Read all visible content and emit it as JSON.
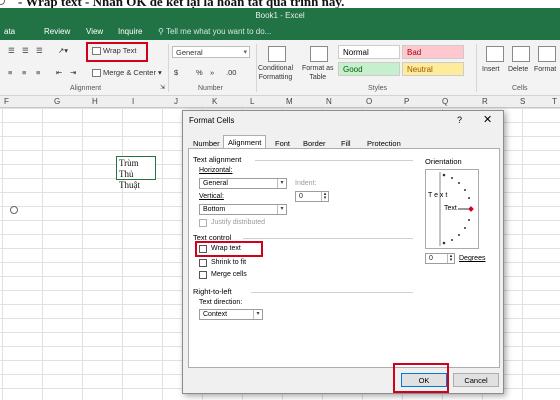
{
  "caption": {
    "text": "- Wrap text - Nhấn OK để kết lại là hoàn tất quá trình này."
  },
  "window": {
    "title": "Book1 - Excel"
  },
  "ribbon_tabs": [
    "ata",
    "Review",
    "View",
    "Inquire"
  ],
  "tell_me": "Tell me what you want to do...",
  "ribbon": {
    "wrap_text": "Wrap Text",
    "merge_center": "Merge & Center",
    "number_format": "General",
    "number_buttons": [
      "$",
      "%",
      "»",
      ".00"
    ],
    "conditional_formatting": "Conditional\nFormatting",
    "format_as_table": "Format as\nTable",
    "styles": [
      {
        "label": "Normal",
        "bg": "#ffffff",
        "fg": "#000000"
      },
      {
        "label": "Bad",
        "bg": "#ffc7ce",
        "fg": "#9c0006"
      },
      {
        "label": "Good",
        "bg": "#c6efce",
        "fg": "#006100"
      },
      {
        "label": "Neutral",
        "bg": "#ffeb9c",
        "fg": "#9c5700"
      }
    ],
    "cells_buttons": [
      "Insert",
      "Delete",
      "Format"
    ],
    "groups": {
      "alignment": "Alignment",
      "number": "Number",
      "styles": "Styles",
      "cells": "Cells"
    }
  },
  "columns": [
    "F",
    "G",
    "H",
    "I",
    "J",
    "K",
    "L",
    "M",
    "N",
    "O",
    "P",
    "Q",
    "R",
    "S",
    "T"
  ],
  "cell": {
    "line1": "Trùm Thủ",
    "line2": "Thuật"
  },
  "dialog": {
    "title": "Format Cells",
    "help": "?",
    "close": "✕",
    "tabs": [
      "Number",
      "Alignment",
      "Font",
      "Border",
      "Fill",
      "Protection"
    ],
    "active_tab": "Alignment",
    "text_alignment": {
      "section": "Text alignment",
      "horizontal_label": "Horizontal:",
      "horizontal_value": "General",
      "indent_label": "Indent:",
      "indent_value": "0",
      "vertical_label": "Vertical:",
      "vertical_value": "Bottom",
      "justify_distributed": "Justify distributed"
    },
    "text_control": {
      "section": "Text control",
      "wrap_text": "Wrap text",
      "shrink_to_fit": "Shrink to fit",
      "merge_cells": "Merge cells"
    },
    "rtl": {
      "section": "Right-to-left",
      "direction_label": "Text direction:",
      "direction_value": "Context"
    },
    "orientation": {
      "section": "Orientation",
      "vertical_text": "T e x t",
      "rotated_text": "Text",
      "degrees_value": "0",
      "degrees_label": "Degrees"
    },
    "ok": "OK",
    "cancel": "Cancel"
  }
}
